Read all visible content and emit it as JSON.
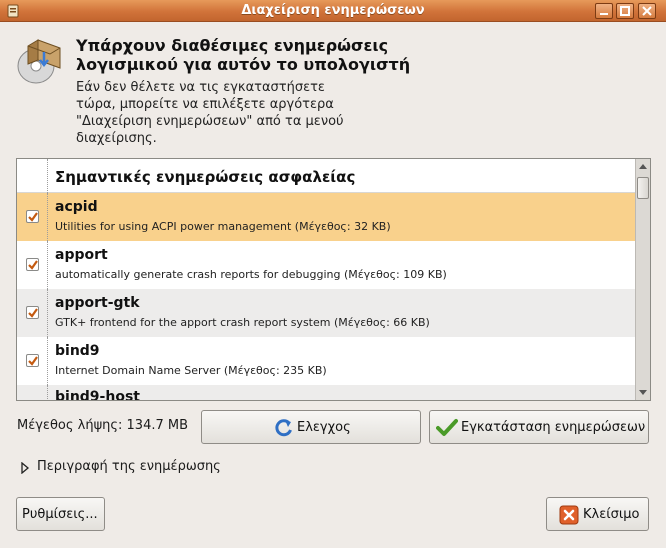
{
  "window": {
    "title": "Διαχείριση ενημερώσεων"
  },
  "header": {
    "heading_line1": "Υπάρχουν διαθέσιμες ενημερώσεις",
    "heading_line2": "λογισμικού για αυτόν το υπολογιστή",
    "desc_line1": "Εάν δεν θέλετε να τις εγκαταστήσετε",
    "desc_line2": "τώρα, μπορείτε να επιλέξετε αργότερα",
    "desc_line3": "\"Διαχείριση ενημερώσεων\" από τα μενού",
    "desc_line4": "διαχείρισης."
  },
  "updates": {
    "group_title": "Σημαντικές ενημερώσεις ασφαλείας",
    "items": [
      {
        "name": "acpid",
        "description": "Utilities for using ACPI power management (Μέγεθος: 32 KB)",
        "checked": true,
        "selected": true
      },
      {
        "name": "apport",
        "description": "automatically generate crash reports for debugging (Μέγεθος: 109 KB)",
        "checked": true,
        "selected": false
      },
      {
        "name": "apport-gtk",
        "description": "GTK+ frontend for the apport crash report system (Μέγεθος: 66 KB)",
        "checked": true,
        "selected": false
      },
      {
        "name": "bind9",
        "description": "Internet Domain Name Server (Μέγεθος: 235 KB)",
        "checked": true,
        "selected": false
      },
      {
        "name": "bind9-host",
        "description": "",
        "checked": true,
        "selected": false
      }
    ]
  },
  "footer": {
    "download_size": "Μέγεθος λήψης: 134.7 MB",
    "check_label": "Ελεγχος",
    "install_label": "Εγκατάσταση ενημερώσεων",
    "details_expander": "Περιγραφή της ενημέρωσης",
    "settings_label": "Ρυθμίσεις...",
    "close_label": "Κλείσιμο"
  },
  "colors": {
    "titlebar": "#d1733a",
    "selection": "#f9d18c",
    "check": "#c45a10"
  }
}
